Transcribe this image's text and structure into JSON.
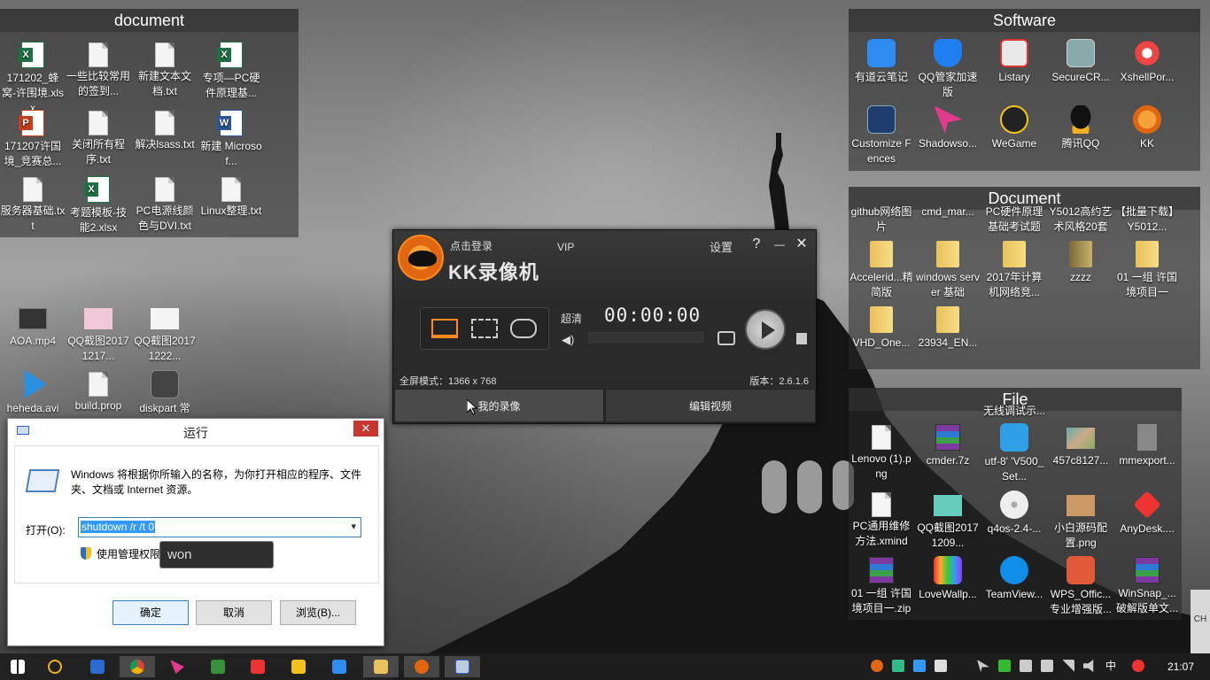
{
  "fences": {
    "document_top": {
      "title": "document",
      "items": [
        {
          "label": "171202_蜂窝-许围境.xlsx",
          "icon": "excel-icon"
        },
        {
          "label": "一些比较常用的签到...",
          "icon": "text-file-icon"
        },
        {
          "label": "新建文本文档.txt",
          "icon": "text-file-icon"
        },
        {
          "label": "专项—PC硬件原理基...",
          "icon": "excel-icon"
        },
        {
          "label": "171207许国境_竞赛总...",
          "icon": "powerpoint-icon"
        },
        {
          "label": "关闭所有程序.txt",
          "icon": "text-file-icon"
        },
        {
          "label": "解决lsass.txt",
          "icon": "text-file-icon"
        },
        {
          "label": "新建 Microsof...",
          "icon": "word-icon"
        },
        {
          "label": "服务器基础.txt",
          "icon": "text-file-icon"
        },
        {
          "label": "考题模板-技能2.xlsx",
          "icon": "excel-icon"
        },
        {
          "label": "PC电源线颜色与DVI.txt",
          "icon": "text-file-icon"
        },
        {
          "label": "Linux整理.txt",
          "icon": "text-file-icon"
        }
      ]
    },
    "software": {
      "title": "Software",
      "items": [
        {
          "label": "有道云笔记",
          "icon": "youdao-note-icon"
        },
        {
          "label": "QQ管家加速版",
          "icon": "qq-manager-icon"
        },
        {
          "label": "Listary",
          "icon": "listary-icon"
        },
        {
          "label": "SecureCR...",
          "icon": "securecrt-icon"
        },
        {
          "label": "XshellPor...",
          "icon": "xshell-icon"
        },
        {
          "label": "Customize Fences",
          "icon": "fences-icon"
        },
        {
          "label": "Shadowso...",
          "icon": "shadowsocks-icon"
        },
        {
          "label": "WeGame",
          "icon": "wegame-icon"
        },
        {
          "label": "腾讯QQ",
          "icon": "qq-penguin-icon"
        },
        {
          "label": "KK",
          "icon": "kk-recorder-icon"
        }
      ]
    },
    "document_right": {
      "title": "Document",
      "top_row": [
        "github网络图片",
        "cmd_mar...",
        "PC硬件原理基础考试题",
        "Y5012高约艺术风格20套",
        "【批量下载】Y5012..."
      ],
      "items": [
        {
          "label": "Accelerid...精简版",
          "icon": "folder-icon"
        },
        {
          "label": "windows server 基础",
          "icon": "folder-icon"
        },
        {
          "label": "2017年计算机网络竞...",
          "icon": "folder-icon"
        },
        {
          "label": "zzzz",
          "icon": "folder-icon"
        },
        {
          "label": "01 一组 许国境项目一",
          "icon": "folder-icon"
        },
        {
          "label": "VHD_One...",
          "icon": "folder-icon"
        },
        {
          "label": "23934_EN...",
          "icon": "folder-icon"
        }
      ]
    },
    "file": {
      "title": "File",
      "top_row": "无线调试示...",
      "items": [
        {
          "label": "Lenovo (1).png",
          "icon": "png-file-icon"
        },
        {
          "label": "cmder.7z",
          "icon": "archive-icon"
        },
        {
          "label": "utf-8' 'V500_Set...",
          "icon": "download-icon"
        },
        {
          "label": "457c8127...",
          "icon": "image-icon"
        },
        {
          "label": "mmexport...",
          "icon": "image-icon"
        },
        {
          "label": "PC通用维修方法.xmind",
          "icon": "text-file-icon"
        },
        {
          "label": "QQ截图20171209...",
          "icon": "image-icon"
        },
        {
          "label": "q4os-2.4-...",
          "icon": "disc-image-icon"
        },
        {
          "label": "小白源码配置.png",
          "icon": "image-icon"
        },
        {
          "label": "AnyDesk....",
          "icon": "anydesk-icon"
        },
        {
          "label": "01 一组 许国境项目一.zip",
          "icon": "archive-icon"
        },
        {
          "label": "LoveWallp...",
          "icon": "lovewallpaper-icon"
        },
        {
          "label": "TeamView...",
          "icon": "teamviewer-icon"
        },
        {
          "label": "WPS_Offic...专业增强版...",
          "icon": "wps-icon"
        },
        {
          "label": "WinSnap_...破解版单文...",
          "icon": "archive-icon"
        }
      ]
    }
  },
  "desktop_icons": [
    {
      "label": "AOA.mp4",
      "icon": "video-file-icon"
    },
    {
      "label": "QQ截图20171217...",
      "icon": "image-icon"
    },
    {
      "label": "QQ截图20171222...",
      "icon": "image-icon"
    },
    {
      "label": "heheda.avi",
      "icon": "avi-file-icon"
    },
    {
      "label": "build.prop",
      "icon": "text-file-icon"
    },
    {
      "label": "diskpart 常",
      "icon": "diskpart-icon"
    }
  ],
  "kk_recorder": {
    "login": "点击登录",
    "vip": "VIP",
    "title": "KK录像机",
    "settings": "设置",
    "help": "?",
    "minimize": "—",
    "close": "✕",
    "quality": "超清",
    "timer": "00:00:00",
    "fullscreen_mode": "全屏模式：1366 x 768",
    "version": "版本：2.6.1.6",
    "tab_my_videos": "我的录像",
    "tab_edit_video": "编辑视频"
  },
  "run_dialog": {
    "title": "运行",
    "close": "✕",
    "description": "Windows 将根据你所输入的名称，为你打开相应的程序、文件夹、文档或 Internet 资源。",
    "open_label": "打开(O):",
    "input_value": "shutdown /r /t 0",
    "admin_label": "使用管理权限创",
    "ok": "确定",
    "cancel": "取消",
    "browse": "浏览(B)..."
  },
  "ime_popup": {
    "text": "won"
  },
  "taskbar": {
    "clock": "21:07",
    "ime_lang": "中",
    "side_label": "CH"
  },
  "colors": {
    "accent": "#e0670f",
    "run_close": "#c7372f",
    "selection": "#3399ff"
  }
}
